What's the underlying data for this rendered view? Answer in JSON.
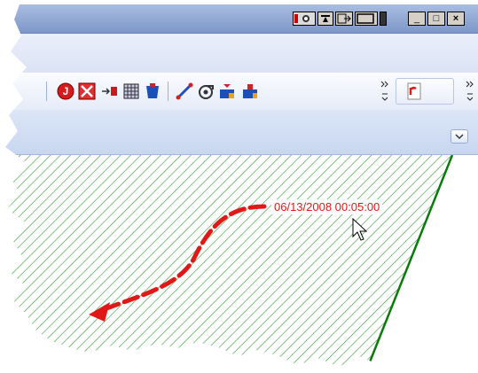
{
  "window": {
    "controls": {
      "minimize": "_",
      "maximize": "□",
      "close": "×"
    }
  },
  "toolbar": {
    "buttons": [
      {
        "icon": "junction-icon",
        "label": "J"
      },
      {
        "icon": "delete-icon",
        "label": "X"
      },
      {
        "icon": "connect-icon"
      },
      {
        "icon": "grid-icon"
      },
      {
        "icon": "tank-icon"
      },
      {
        "icon": "pipe-icon"
      },
      {
        "icon": "pump-icon"
      },
      {
        "icon": "reservoir-icon"
      },
      {
        "icon": "valve-icon"
      },
      {
        "icon": "report-icon"
      }
    ]
  },
  "canvas": {
    "timestamp": "06/13/2008 00:05:00",
    "hatch_color": "#2f9a2f",
    "edge_color": "#0a7a0a",
    "arrow_color": "#e01818"
  }
}
